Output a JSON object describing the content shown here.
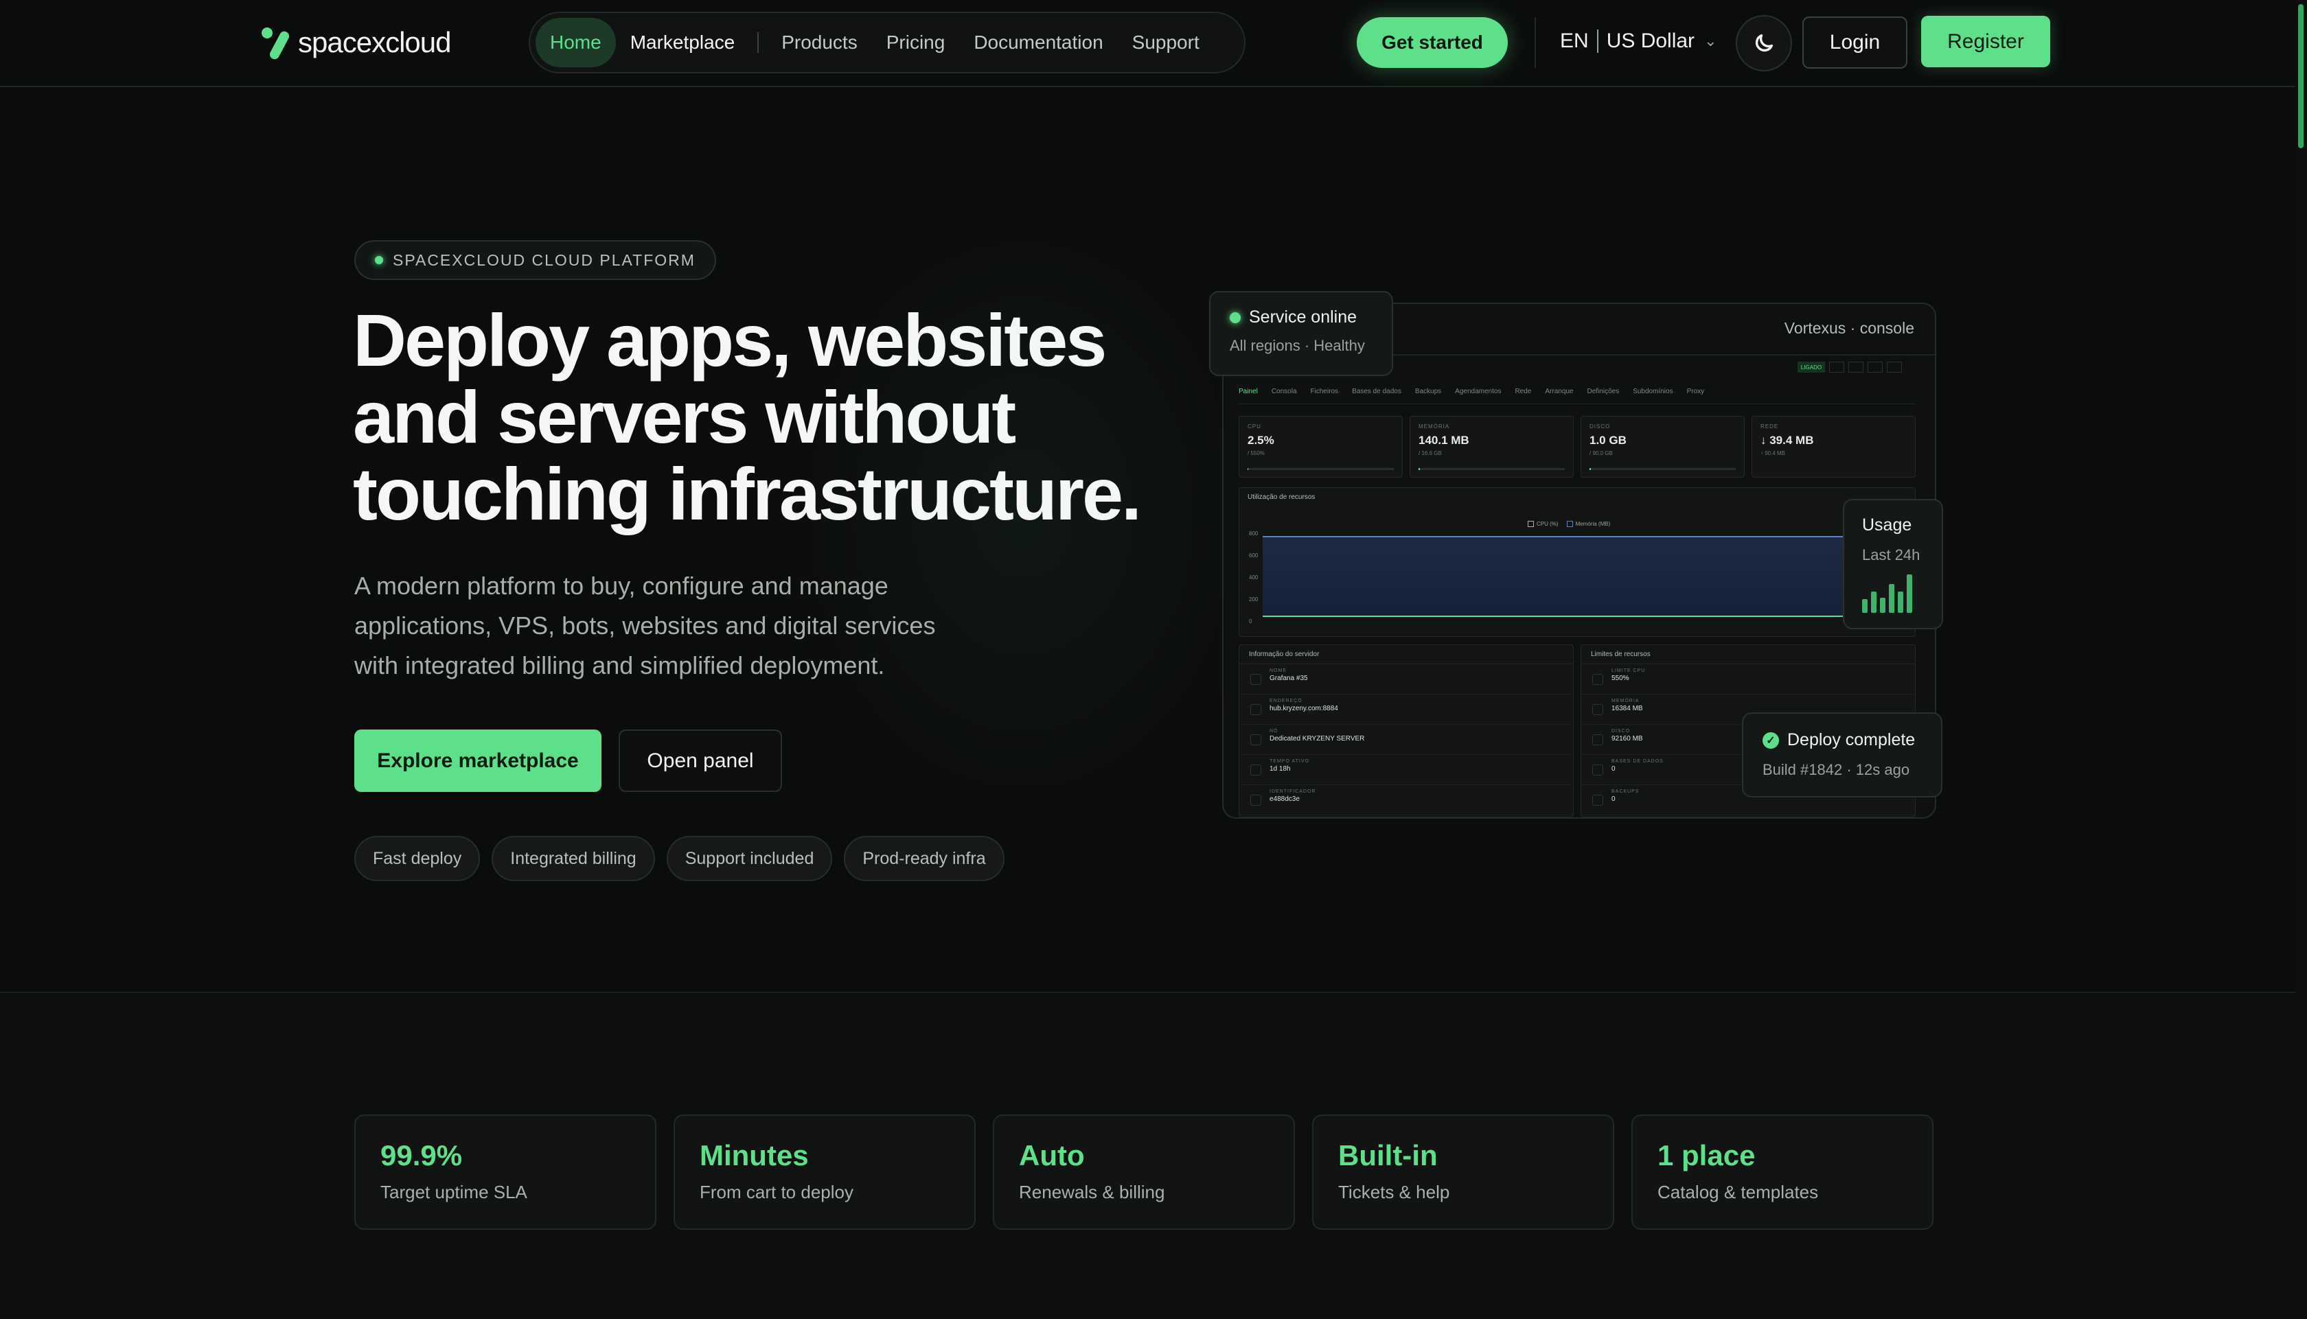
{
  "nav": {
    "logo_text": "spacexcloud",
    "links": [
      {
        "label": "Home",
        "active": true
      },
      {
        "label": "Marketplace"
      },
      {
        "label": "Products"
      },
      {
        "label": "Pricing"
      },
      {
        "label": "Documentation"
      },
      {
        "label": "Support"
      }
    ],
    "get_started": "Get started",
    "language": "EN",
    "currency": "US Dollar",
    "login": "Login",
    "register": "Register"
  },
  "hero": {
    "badge": "SPACEXCLOUD CLOUD PLATFORM",
    "headline": "Deploy apps, websites and servers without touching infrastructure.",
    "subtext": "A modern platform to buy, configure and manage applications, VPS, bots, websites and digital services with integrated billing and simplified deployment.",
    "cta_primary": "Explore marketplace",
    "cta_secondary": "Open panel",
    "tags": [
      "Fast deploy",
      "Integrated billing",
      "Support included",
      "Prod-ready infra"
    ]
  },
  "console": {
    "title": "Vortexus · console",
    "live": "LIGADO",
    "tabs": [
      "Painel",
      "Consola",
      "Ficheiros",
      "Bases de dados",
      "Backups",
      "Agendamentos",
      "Rede",
      "Arranque",
      "Definições",
      "Subdomínios",
      "Proxy"
    ],
    "stats": [
      {
        "label": "CPU",
        "value": "2.5%",
        "sub": "/ 550%",
        "fill": 0.005
      },
      {
        "label": "MEMÓRIA",
        "value": "140.1 MB",
        "sub": "/ 16.6 GB",
        "fill": 0.01
      },
      {
        "label": "DISCO",
        "value": "1.0 GB",
        "sub": "/ 90.0 GB",
        "fill": 0.011
      },
      {
        "label": "REDE",
        "value": "↓ 39.4 MB",
        "sub": "↑ 90.4 MB",
        "fill": 0
      }
    ],
    "chart": {
      "title": "Utilização de recursos",
      "legend": [
        "CPU (%)",
        "Memória (MB)"
      ],
      "yticks": [
        "800",
        "600",
        "400",
        "200",
        "0"
      ]
    },
    "server_info": {
      "title": "Informação do servidor",
      "rows": [
        {
          "k": "NOME",
          "v": "Grafana #35"
        },
        {
          "k": "ENDEREÇO",
          "v": "hub.kryzeny.com:8884"
        },
        {
          "k": "NÓ",
          "v": "Dedicated KRYZENY SERVER"
        },
        {
          "k": "TEMPO ATIVO",
          "v": "1d 18h"
        },
        {
          "k": "IDENTIFICADOR",
          "v": "e488dc3e"
        }
      ]
    },
    "limits": {
      "title": "Limites de recursos",
      "rows": [
        {
          "k": "LIMITE CPU",
          "v": "550%"
        },
        {
          "k": "MEMÓRIA",
          "v": "16384 MB"
        },
        {
          "k": "DISCO",
          "v": "92160 MB"
        },
        {
          "k": "BASES DE DADOS",
          "v": "0"
        },
        {
          "k": "BACKUPS",
          "v": "0"
        }
      ]
    }
  },
  "cards": {
    "online_title": "Service online",
    "online_sub": "All regions · Healthy",
    "usage_title": "Usage",
    "usage_sub": "Last 24h",
    "usage_bars": [
      0.35,
      0.55,
      0.4,
      0.75,
      0.55,
      1.0
    ],
    "deploy_title": "Deploy complete",
    "deploy_sub": "Build #1842 · 12s ago"
  },
  "stats": [
    {
      "big": "99.9%",
      "small": "Target uptime SLA"
    },
    {
      "big": "Minutes",
      "small": "From cart to deploy"
    },
    {
      "big": "Auto",
      "small": "Renewals & billing"
    },
    {
      "big": "Built-in",
      "small": "Tickets & help"
    },
    {
      "big": "1 place",
      "small": "Catalog & templates"
    }
  ],
  "colors": {
    "accent": "#5ee08a",
    "background": "#0b0c0c"
  }
}
